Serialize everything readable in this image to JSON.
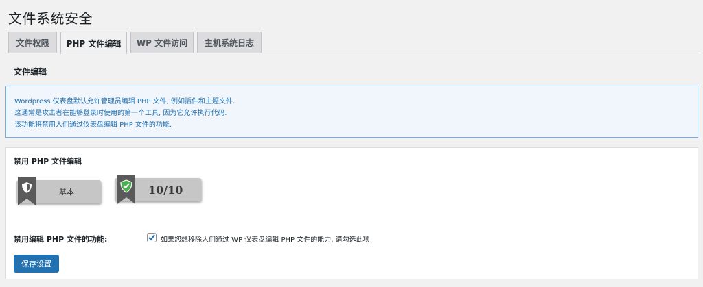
{
  "page": {
    "title": "文件系统安全"
  },
  "tabs": [
    {
      "label": "文件权限"
    },
    {
      "label": "PHP 文件编辑"
    },
    {
      "label": "WP 文件访问"
    },
    {
      "label": "主机系统日志"
    }
  ],
  "section": {
    "heading": "文件编辑"
  },
  "info": {
    "lines": [
      "Wordpress 仪表盘默认允许管理员编辑 PHP 文件, 例如插件和主题文件.",
      "这通常是攻击者在能够登录时使用的第一个工具, 因为它允许执行代码.",
      "该功能将禁用人们通过仪表盘编辑 PHP 文件的功能."
    ]
  },
  "card": {
    "title": "禁用 PHP 文件编辑",
    "badge_level": "基本",
    "badge_score": "10/10",
    "setting_label": "禁用编辑 PHP 文件的功能:",
    "checkbox_checked": true,
    "checkbox_description": "如果您想移除人们通过 WP 仪表盘编辑 PHP 文件的能力, 请勾选此项",
    "save_label": "保存设置"
  },
  "colors": {
    "accent": "#2271b1",
    "info_border": "#72aee6",
    "info_bg": "#f0f6fc",
    "ribbon_dark": "#5a5a5a",
    "ribbon_green": "#4caf50"
  }
}
